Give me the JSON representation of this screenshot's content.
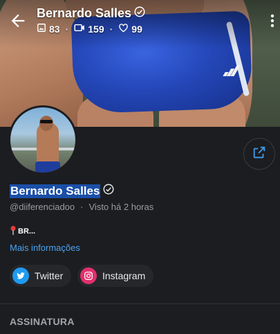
{
  "header": {
    "name": "Bernardo Salles",
    "photos": "83",
    "videos": "159",
    "likes": "99"
  },
  "profile": {
    "display_name": "Bernardo Salles",
    "handle": "@diiferenciadoo",
    "seen_label": "Visto",
    "seen_time": "há 2 horas",
    "bio": "BR...",
    "more_info": "Mais informações"
  },
  "social": {
    "twitter": "Twitter",
    "instagram": "Instagram"
  },
  "sections": {
    "subscription": "ASSINATURA"
  },
  "colors": {
    "link": "#4aa3f0",
    "twitter": "#1d9bf0",
    "instagram": "#e1306c",
    "selection": "#1a4fa8"
  }
}
